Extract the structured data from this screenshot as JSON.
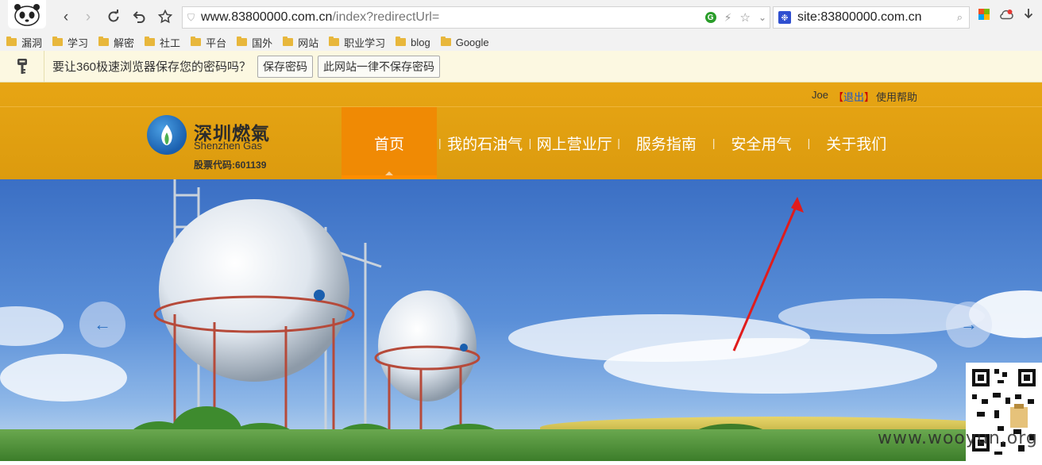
{
  "browser": {
    "url_host": "www.83800000.com.cn",
    "url_path": "/index?redirectUrl=",
    "search_query": "site:83800000.com.cn"
  },
  "bookmarks": [
    "漏洞",
    "学习",
    "解密",
    "社工",
    "平台",
    "国外",
    "网站",
    "职业学习",
    "blog",
    "Google"
  ],
  "password_bar": {
    "prompt": "要让360极速浏览器保存您的密码吗？",
    "save_label": "保存密码",
    "never_label": "此网站一律不保存密码"
  },
  "site": {
    "user_name": "Joe",
    "logout_open": "【",
    "logout_label": "退出",
    "logout_close": "】",
    "help_label": "使用帮助",
    "logo_cn": "深圳燃氣",
    "logo_en": "Shenzhen Gas",
    "stock_code": "股票代码:601139",
    "nav": [
      "首页",
      "我的石油气",
      "网上营业厅",
      "服务指南",
      "安全用气",
      "关于我们"
    ],
    "nav_active": 0
  },
  "hero": {
    "prev_icon": "←",
    "next_icon": "→",
    "watermark": "www.wooyun.org"
  },
  "colors": {
    "header_bg": "#dc9b0e",
    "nav_active_bg": "#f08a04",
    "link_blue": "#1f58c7"
  }
}
